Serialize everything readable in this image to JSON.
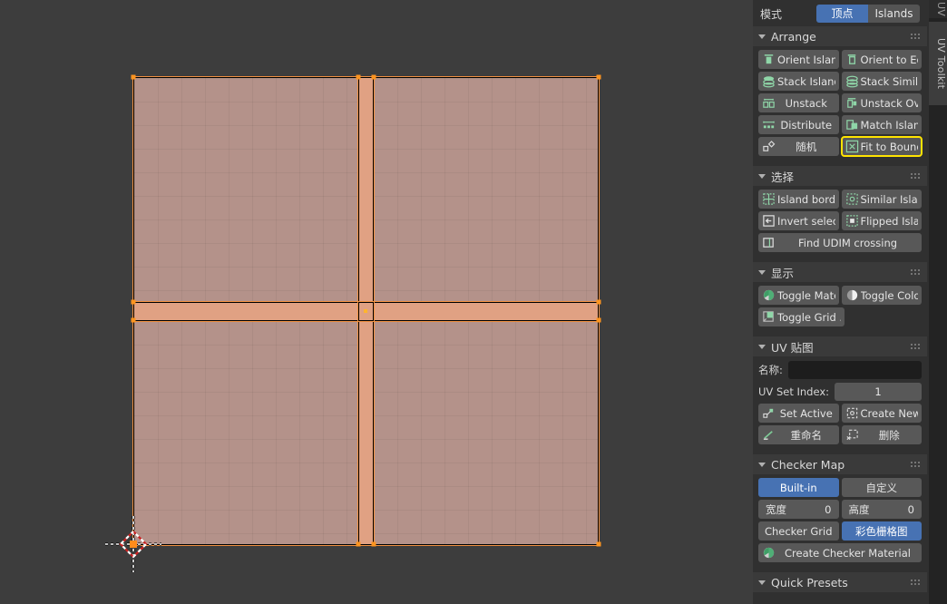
{
  "viewport": {
    "name": "uv-editor-viewport",
    "background_color": "#3d3d3d",
    "face_fill_color": "#b4928a",
    "strip_fill_color": "#e0a183",
    "edge_color": "#f09040",
    "vertex_color": "#ff9520",
    "cursor_label": "2d-cursor"
  },
  "panel": {
    "tabs": {
      "active": "UV Toolkit",
      "partial_above": "UV"
    },
    "mode": {
      "label": "模式",
      "options": [
        "顶点",
        "Islands"
      ],
      "selected": "顶点"
    },
    "sections": [
      {
        "id": "arrange",
        "title": "Arrange",
        "expanded": true,
        "rows": [
          [
            {
              "label": "Orient Islands",
              "icon": "orient-islands-icon",
              "align": "left"
            },
            {
              "label": "Orient to Edge",
              "icon": "orient-to-edge-icon",
              "align": "left"
            }
          ],
          [
            {
              "label": "Stack Islands",
              "icon": "stack-islands-icon",
              "align": "left"
            },
            {
              "label": "Stack Similar",
              "icon": "stack-similar-icon",
              "align": "left"
            }
          ],
          [
            {
              "label": "Unstack",
              "icon": "unstack-icon",
              "align": "center"
            },
            {
              "label": "Unstack Ov...",
              "icon": "unstack-overlapping-icon",
              "align": "left"
            }
          ],
          [
            {
              "label": "Distribute",
              "icon": "distribute-icon",
              "align": "center"
            },
            {
              "label": "Match Islands",
              "icon": "match-islands-icon",
              "align": "left"
            }
          ],
          [
            {
              "label": "随机",
              "icon": "randomize-icon",
              "align": "center"
            },
            {
              "label": "Fit to Bounds",
              "icon": "fit-to-bounds-icon",
              "align": "left",
              "highlight": true
            }
          ]
        ]
      },
      {
        "id": "select",
        "title": "选择",
        "expanded": true,
        "rows": [
          [
            {
              "label": "Island border",
              "icon": "island-border-icon",
              "align": "left"
            },
            {
              "label": "Similar Islan...",
              "icon": "similar-islands-icon",
              "align": "left"
            }
          ],
          [
            {
              "label": "Invert select...",
              "icon": "invert-selection-icon",
              "align": "left"
            },
            {
              "label": "Flipped Islan...",
              "icon": "flipped-islands-icon",
              "align": "left"
            }
          ],
          [
            {
              "label": "Find UDIM crossing",
              "icon": "find-udim-crossing-icon",
              "align": "center",
              "full": true
            }
          ]
        ]
      },
      {
        "id": "display",
        "title": "显示",
        "expanded": true,
        "rows": [
          [
            {
              "label": "Toggle Mate...",
              "icon": "toggle-material-icon",
              "align": "left"
            },
            {
              "label": "Toggle Color...",
              "icon": "toggle-color-icon",
              "align": "left"
            }
          ],
          [
            {
              "label": "Toggle Grid ...",
              "icon": "toggle-grid-icon",
              "align": "left",
              "half": true
            }
          ]
        ]
      },
      {
        "id": "uvmap",
        "title": "UV 贴图",
        "expanded": true,
        "name_label": "名称:",
        "name_value": "",
        "uv_set_index_label": "UV Set Index:",
        "uv_set_index_value": "1",
        "rows": [
          [
            {
              "label": "Set Active",
              "icon": "set-active-icon",
              "align": "center"
            },
            {
              "label": "Create New",
              "icon": "create-new-icon",
              "align": "center"
            }
          ],
          [
            {
              "label": "重命名",
              "icon": "rename-icon",
              "align": "center"
            },
            {
              "label": "删除",
              "icon": "delete-icon",
              "align": "center"
            }
          ]
        ]
      },
      {
        "id": "checkermap",
        "title": "Checker Map",
        "expanded": true,
        "source_options": [
          "Built-in",
          "自定义"
        ],
        "source_selected": "Built-in",
        "width_label": "宽度",
        "width_value": "0",
        "height_label": "高度",
        "height_value": "0",
        "grid_options": [
          "Checker Grid",
          "彩色栅格图"
        ],
        "grid_selected": "彩色栅格图",
        "create_material_label": "Create Checker Material",
        "create_material_icon": "material-sphere-icon"
      },
      {
        "id": "quickpresets",
        "title": "Quick Presets",
        "expanded": true
      }
    ]
  },
  "colors": {
    "accent_blue": "#4772b3",
    "highlight_yellow": "#ffe300",
    "icon_green": "#8fd6a8",
    "panel_bg": "#303030",
    "header_bg": "#3a3a3a",
    "button_bg": "#585858"
  }
}
